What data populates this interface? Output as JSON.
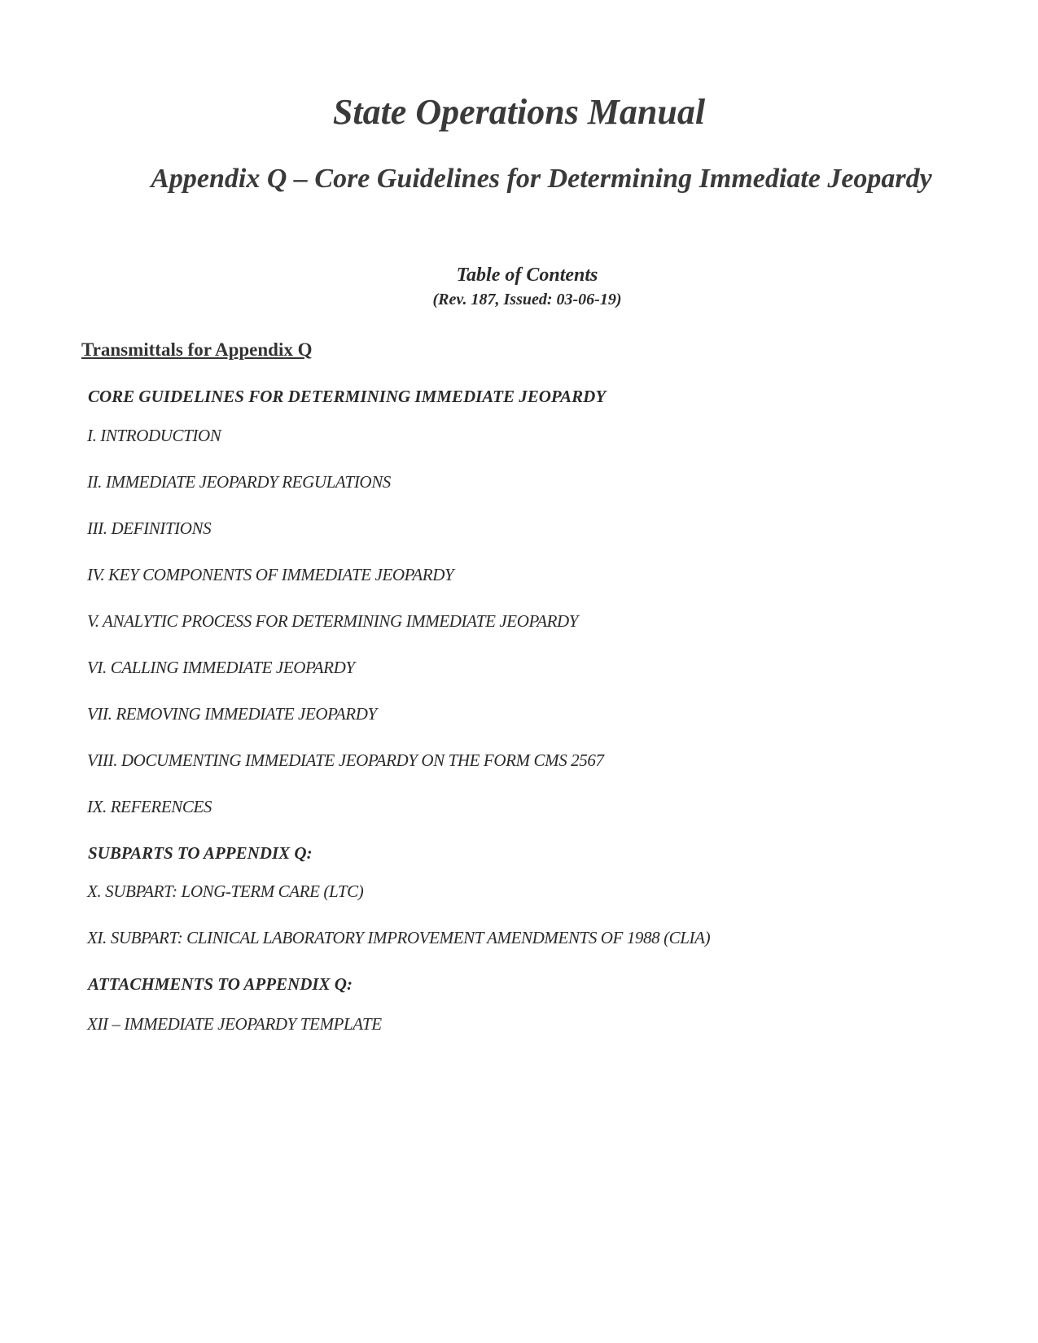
{
  "document": {
    "title": "State Operations Manual",
    "subtitle": "Appendix Q – Core Guidelines for Determining Immediate Jeopardy",
    "toc_heading": "Table of Contents",
    "revision": "(Rev. 187, Issued: 03-06-19)"
  },
  "transmittals": {
    "label": "Transmittals for Appendix Q"
  },
  "sections": {
    "core": {
      "heading": "CORE GUIDELINES FOR DETERMINING IMMEDIATE JEOPARDY",
      "items": [
        "I.  INTRODUCTION",
        "II. IMMEDIATE JEOPARDY REGULATIONS",
        "III. DEFINITIONS",
        "IV. KEY COMPONENTS OF IMMEDIATE JEOPARDY",
        "V.  ANALYTIC PROCESS FOR DETERMINING IMMEDIATE JEOPARDY",
        "VI. CALLING IMMEDIATE JEOPARDY",
        "VII. REMOVING IMMEDIATE JEOPARDY",
        "VIII. DOCUMENTING IMMEDIATE JEOPARDY ON THE FORM CMS 2567",
        "IX. REFERENCES"
      ]
    },
    "subparts": {
      "heading": "SUBPARTS TO APPENDIX Q:",
      "items": [
        "X.  SUBPART:   LONG-TERM CARE (LTC)",
        "XI. SUBPART:  CLINICAL LABORATORY IMPROVEMENT AMENDMENTS OF 1988 (CLIA)"
      ]
    },
    "attachments": {
      "heading": "ATTACHMENTS TO APPENDIX Q:",
      "items": [
        "XII – IMMEDIATE JEOPARDY TEMPLATE"
      ]
    }
  }
}
